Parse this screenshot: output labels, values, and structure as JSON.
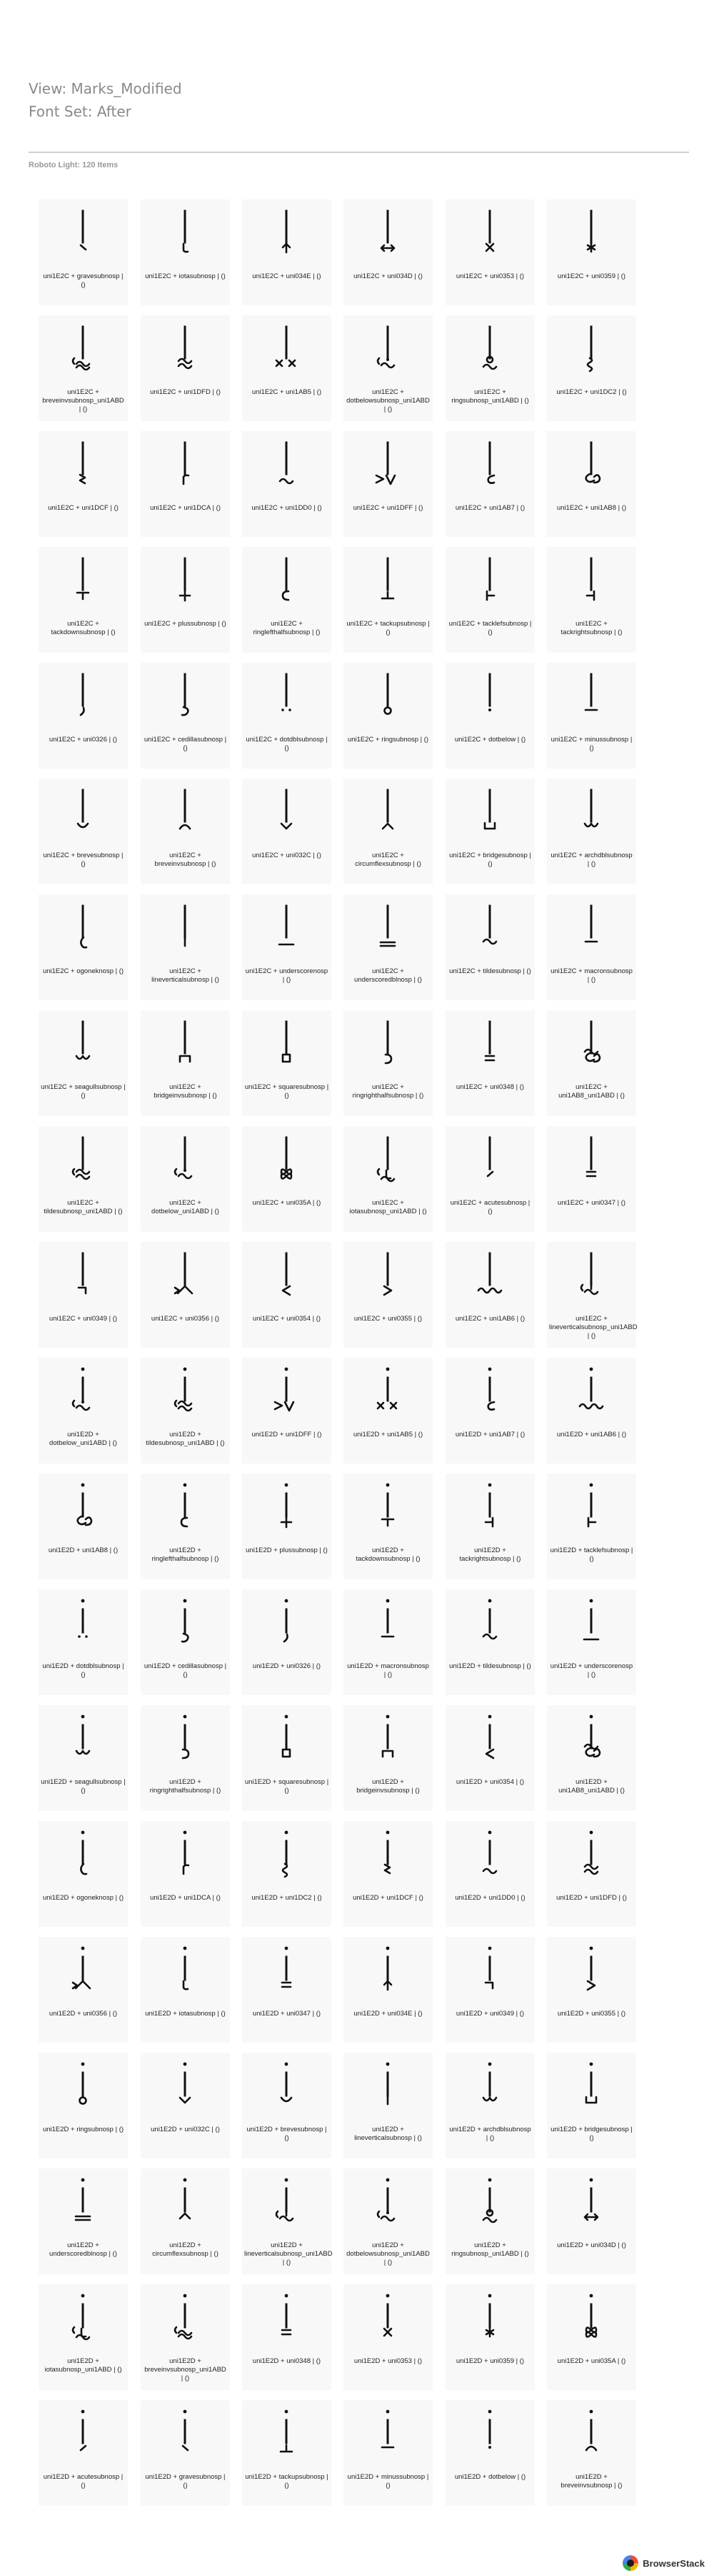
{
  "header": {
    "view_title": "View: Marks_Modified",
    "fontset_title": "Font Set: After",
    "subtitle": "Roboto Light: 120 Items"
  },
  "items": [
    {
      "label": "uni1E2C + gravesubnosp | ()",
      "mark": "grave"
    },
    {
      "label": "uni1E2C + iotasubnosp | ()",
      "mark": "iota"
    },
    {
      "label": "uni1E2C + uni034E | ()",
      "mark": "uparrow"
    },
    {
      "label": "uni1E2C + uni034D | ()",
      "mark": "leftright"
    },
    {
      "label": "uni1E2C + uni0353 | ()",
      "mark": "x"
    },
    {
      "label": "uni1E2C + uni0359 | ()",
      "mark": "asterisk"
    },
    {
      "label": "uni1E2C + breveinvsubnosp_uni1ABD | ()",
      "mark": "breveinv-tilde"
    },
    {
      "label": "uni1E2C + uni1DFD | ()",
      "mark": "almostequal"
    },
    {
      "label": "uni1E2C + uni1AB5 | ()",
      "mark": "xx"
    },
    {
      "label": "uni1E2C + dotbelowsubnosp_uni1ABD | ()",
      "mark": "dotbelow-tilde"
    },
    {
      "label": "uni1E2C + ringsubnosp_uni1ABD | ()",
      "mark": "ring-tilde"
    },
    {
      "label": "uni1E2C + uni1DC2 | ()",
      "mark": "snake"
    },
    {
      "label": "uni1E2C + uni1DCF | ()",
      "mark": "zigzag"
    },
    {
      "label": "uni1E2C + uni1DCA | ()",
      "mark": "r"
    },
    {
      "label": "uni1E2C + uni1DD0 | ()",
      "mark": "tilde-low"
    },
    {
      "label": "uni1E2C + uni1DFF | ()",
      "mark": "arrowleft-v"
    },
    {
      "label": "uni1E2C + uni1AB7 | ()",
      "mark": "openmark"
    },
    {
      "label": "uni1E2C + uni1AB8 | ()",
      "mark": "doubleopen"
    },
    {
      "label": "uni1E2C + tackdownsubnosp | ()",
      "mark": "tackdown"
    },
    {
      "label": "uni1E2C + plussubnosp | ()",
      "mark": "plus"
    },
    {
      "label": "uni1E2C + ringlefthalfsubnosp | ()",
      "mark": "ringleft"
    },
    {
      "label": "uni1E2C + tackupsubnosp | ()",
      "mark": "tackup"
    },
    {
      "label": "uni1E2C + tacklefsubnosp | ()",
      "mark": "tackleft"
    },
    {
      "label": "uni1E2C + tackrightsubnosp | ()",
      "mark": "tackright"
    },
    {
      "label": "uni1E2C + uni0326 | ()",
      "mark": "comma"
    },
    {
      "label": "uni1E2C + cedillasubnosp | ()",
      "mark": "cedilla"
    },
    {
      "label": "uni1E2C + dotdblsubnosp | ()",
      "mark": "dieresis"
    },
    {
      "label": "uni1E2C + ringsubnosp | ()",
      "mark": "ring"
    },
    {
      "label": "uni1E2C + dotbelow | ()",
      "mark": "dot"
    },
    {
      "label": "uni1E2C + minussubnosp | ()",
      "mark": "minus"
    },
    {
      "label": "uni1E2C + brevesubnosp | ()",
      "mark": "breve"
    },
    {
      "label": "uni1E2C + breveinvsubnosp | ()",
      "mark": "breveinv"
    },
    {
      "label": "uni1E2C + uni032C | ()",
      "mark": "caron"
    },
    {
      "label": "uni1E2C + circumflexsubnosp | ()",
      "mark": "circumflex"
    },
    {
      "label": "uni1E2C + bridgesubnosp | ()",
      "mark": "bridge"
    },
    {
      "label": "uni1E2C + archdblsubnosp | ()",
      "mark": "archdbl"
    },
    {
      "label": "uni1E2C + ogoneknosp | ()",
      "mark": "ogonek"
    },
    {
      "label": "uni1E2C + lineverticalsubnosp | ()",
      "mark": "linevert"
    },
    {
      "label": "uni1E2C + underscorenosp | ()",
      "mark": "underscore"
    },
    {
      "label": "uni1E2C + underscoredblnosp | ()",
      "mark": "underscoredbl"
    },
    {
      "label": "uni1E2C + tildesubnosp | ()",
      "mark": "tilde"
    },
    {
      "label": "uni1E2C + macronsubnosp | ()",
      "mark": "macron"
    },
    {
      "label": "uni1E2C + seagullsubnosp | ()",
      "mark": "seagull"
    },
    {
      "label": "uni1E2C + bridgeinvsubnosp | ()",
      "mark": "bridgeinv"
    },
    {
      "label": "uni1E2C + squaresubnosp | ()",
      "mark": "square"
    },
    {
      "label": "uni1E2C + ringrighthalfsubnosp | ()",
      "mark": "ringright"
    },
    {
      "label": "uni1E2C + uni0348 | ()",
      "mark": "equals"
    },
    {
      "label": "uni1E2C + uni1AB8_uni1ABD | ()",
      "mark": "doubleopen-tilde"
    },
    {
      "label": "uni1E2C + tildesubnosp_uni1ABD | ()",
      "mark": "tilde-tilde"
    },
    {
      "label": "uni1E2C + dotbelow_uni1ABD | ()",
      "mark": "dotbelow-tilde"
    },
    {
      "label": "uni1E2C + uni035A | ()",
      "mark": "infinity"
    },
    {
      "label": "uni1E2C + iotasubnosp_uni1ABD | ()",
      "mark": "iota-tilde"
    },
    {
      "label": "uni1E2C + acutesubnosp | ()",
      "mark": "acute"
    },
    {
      "label": "uni1E2C + uni0347 | ()",
      "mark": "equals"
    },
    {
      "label": "uni1E2C + uni0349 | ()",
      "mark": "anglebelow"
    },
    {
      "label": "uni1E2C + uni0356 | ()",
      "mark": "rightarrowhead-up"
    },
    {
      "label": "uni1E2C + uni0354 | ()",
      "mark": "lessthan"
    },
    {
      "label": "uni1E2C + uni0355 | ()",
      "mark": "greaterthan"
    },
    {
      "label": "uni1E2C + uni1AB6 | ()",
      "mark": "wiggly"
    },
    {
      "label": "uni1E2C + lineverticalsubnosp_uni1ABD | ()",
      "mark": "linevert-tilde"
    },
    {
      "label": "uni1E2D + dotbelow_uni1ABD | ()",
      "mark": "dotbelow-tilde"
    },
    {
      "label": "uni1E2D + tildesubnosp_uni1ABD | ()",
      "mark": "tilde-tilde"
    },
    {
      "label": "uni1E2D + uni1DFF | ()",
      "mark": "arrowleft-v"
    },
    {
      "label": "uni1E2D + uni1AB5 | ()",
      "mark": "xx"
    },
    {
      "label": "uni1E2D + uni1AB7 | ()",
      "mark": "openmark"
    },
    {
      "label": "uni1E2D + uni1AB6 | ()",
      "mark": "wiggly"
    },
    {
      "label": "uni1E2D + uni1AB8 | ()",
      "mark": "doubleopen"
    },
    {
      "label": "uni1E2D + ringlefthalfsubnosp | ()",
      "mark": "ringleft"
    },
    {
      "label": "uni1E2D + plussubnosp | ()",
      "mark": "plus"
    },
    {
      "label": "uni1E2D + tackdownsubnosp | ()",
      "mark": "tackdown"
    },
    {
      "label": "uni1E2D + tackrightsubnosp | ()",
      "mark": "tackright"
    },
    {
      "label": "uni1E2D + tacklefsubnosp | ()",
      "mark": "tackleft"
    },
    {
      "label": "uni1E2D + dotdblsubnosp | ()",
      "mark": "dieresis"
    },
    {
      "label": "uni1E2D + cedillasubnosp | ()",
      "mark": "cedilla"
    },
    {
      "label": "uni1E2D + uni0326 | ()",
      "mark": "comma"
    },
    {
      "label": "uni1E2D + macronsubnosp | ()",
      "mark": "macron"
    },
    {
      "label": "uni1E2D + tildesubnosp | ()",
      "mark": "tilde"
    },
    {
      "label": "uni1E2D + underscorenosp | ()",
      "mark": "underscore"
    },
    {
      "label": "uni1E2D + seagullsubnosp | ()",
      "mark": "seagull"
    },
    {
      "label": "uni1E2D + ringrighthalfsubnosp | ()",
      "mark": "ringright"
    },
    {
      "label": "uni1E2D + squaresubnosp | ()",
      "mark": "square"
    },
    {
      "label": "uni1E2D + bridgeinvsubnosp | ()",
      "mark": "bridgeinv"
    },
    {
      "label": "uni1E2D + uni0354 | ()",
      "mark": "lessthan"
    },
    {
      "label": "uni1E2D + uni1AB8_uni1ABD | ()",
      "mark": "doubleopen-tilde"
    },
    {
      "label": "uni1E2D + ogoneknosp | ()",
      "mark": "ogonek"
    },
    {
      "label": "uni1E2D + uni1DCA | ()",
      "mark": "r"
    },
    {
      "label": "uni1E2D + uni1DC2 | ()",
      "mark": "snake"
    },
    {
      "label": "uni1E2D + uni1DCF | ()",
      "mark": "zigzag"
    },
    {
      "label": "uni1E2D + uni1DD0 | ()",
      "mark": "tilde-low"
    },
    {
      "label": "uni1E2D + uni1DFD | ()",
      "mark": "almostequal"
    },
    {
      "label": "uni1E2D + uni0356 | ()",
      "mark": "rightarrowhead-up"
    },
    {
      "label": "uni1E2D + iotasubnosp | ()",
      "mark": "iota"
    },
    {
      "label": "uni1E2D + uni0347 | ()",
      "mark": "equals"
    },
    {
      "label": "uni1E2D + uni034E | ()",
      "mark": "uparrow"
    },
    {
      "label": "uni1E2D + uni0349 | ()",
      "mark": "anglebelow"
    },
    {
      "label": "uni1E2D + uni0355 | ()",
      "mark": "greaterthan"
    },
    {
      "label": "uni1E2D + ringsubnosp | ()",
      "mark": "ring"
    },
    {
      "label": "uni1E2D + uni032C | ()",
      "mark": "caron"
    },
    {
      "label": "uni1E2D + brevesubnosp | ()",
      "mark": "breve"
    },
    {
      "label": "uni1E2D + lineverticalsubnosp | ()",
      "mark": "linevert"
    },
    {
      "label": "uni1E2D + archdblsubnosp | ()",
      "mark": "archdbl"
    },
    {
      "label": "uni1E2D + bridgesubnosp | ()",
      "mark": "bridge"
    },
    {
      "label": "uni1E2D + underscoredblnosp | ()",
      "mark": "underscoredbl"
    },
    {
      "label": "uni1E2D + circumflexsubnosp | ()",
      "mark": "circumflex"
    },
    {
      "label": "uni1E2D + lineverticalsubnosp_uni1ABD | ()",
      "mark": "linevert-tilde"
    },
    {
      "label": "uni1E2D + dotbelowsubnosp_uni1ABD | ()",
      "mark": "dotbelow-tilde"
    },
    {
      "label": "uni1E2D + ringsubnosp_uni1ABD | ()",
      "mark": "ring-tilde"
    },
    {
      "label": "uni1E2D + uni034D | ()",
      "mark": "leftright"
    },
    {
      "label": "uni1E2D + iotasubnosp_uni1ABD | ()",
      "mark": "iota-tilde"
    },
    {
      "label": "uni1E2D + breveinvsubnosp_uni1ABD | ()",
      "mark": "breveinv-tilde"
    },
    {
      "label": "uni1E2D + uni0348 | ()",
      "mark": "equals"
    },
    {
      "label": "uni1E2D + uni0353 | ()",
      "mark": "x"
    },
    {
      "label": "uni1E2D + uni0359 | ()",
      "mark": "asterisk"
    },
    {
      "label": "uni1E2D + uni035A | ()",
      "mark": "infinity"
    },
    {
      "label": "uni1E2D + acutesubnosp | ()",
      "mark": "acute"
    },
    {
      "label": "uni1E2D + gravesubnosp | ()",
      "mark": "grave"
    },
    {
      "label": "uni1E2D + tackupsubnosp | ()",
      "mark": "tackup"
    },
    {
      "label": "uni1E2D + minussubnosp | ()",
      "mark": "minus"
    },
    {
      "label": "uni1E2D + dotbelow | ()",
      "mark": "dot"
    },
    {
      "label": "uni1E2D + breveinvsubnosp | ()",
      "mark": "breveinv"
    }
  ],
  "footer": {
    "brand_label": "BrowserStack"
  }
}
